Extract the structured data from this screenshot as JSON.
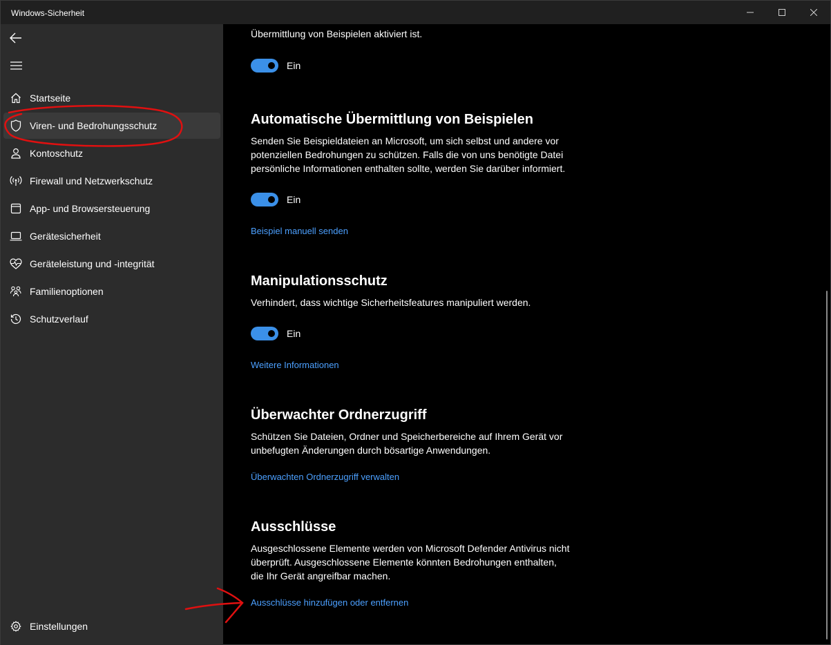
{
  "window": {
    "title": "Windows-Sicherheit"
  },
  "sidebar": {
    "items": [
      {
        "label": "Startseite",
        "icon": "home-icon"
      },
      {
        "label": "Viren- und Bedrohungsschutz",
        "icon": "shield-icon",
        "selected": true
      },
      {
        "label": "Kontoschutz",
        "icon": "person-icon"
      },
      {
        "label": "Firewall und Netzwerkschutz",
        "icon": "wifi-antenna-icon"
      },
      {
        "label": "App- und Browsersteuerung",
        "icon": "browser-window-icon"
      },
      {
        "label": "Gerätesicherheit",
        "icon": "laptop-icon"
      },
      {
        "label": "Geräteleistung und -integrität",
        "icon": "heart-pulse-icon"
      },
      {
        "label": "Familienoptionen",
        "icon": "family-icon"
      },
      {
        "label": "Schutzverlauf",
        "icon": "history-icon"
      }
    ],
    "settings_label": "Einstellungen"
  },
  "content": {
    "top_fragment": "Übermittlung von Beispielen aktiviert ist.",
    "top_toggle_label": "Ein",
    "auto_sample": {
      "title": "Automatische Übermittlung von Beispielen",
      "lines": [
        "Senden Sie Beispieldateien an Microsoft, um sich selbst und andere vor",
        "potenziellen Bedrohungen zu schützen. Falls die von uns benötigte Datei",
        "persönliche Informationen enthalten sollte, werden Sie darüber informiert."
      ],
      "toggle_label": "Ein",
      "link": "Beispiel manuell senden"
    },
    "tamper": {
      "title": "Manipulationsschutz",
      "lines": [
        "Verhindert, dass wichtige Sicherheitsfeatures manipuliert werden."
      ],
      "toggle_label": "Ein",
      "link": "Weitere Informationen"
    },
    "folder_access": {
      "title": "Überwachter Ordnerzugriff",
      "lines": [
        "Schützen Sie Dateien, Ordner und Speicherbereiche auf Ihrem Gerät vor",
        "unbefugten Änderungen durch bösartige Anwendungen."
      ],
      "link": "Überwachten Ordnerzugriff verwalten"
    },
    "exclusions": {
      "title": "Ausschlüsse",
      "lines": [
        "Ausgeschlossene Elemente werden von Microsoft Defender Antivirus nicht",
        "überprüft. Ausgeschlossene Elemente könnten Bedrohungen enthalten,",
        "die Ihr Gerät angreifbar machen."
      ],
      "link": "Ausschlüsse hinzufügen oder entfernen"
    }
  },
  "colors": {
    "accent": "#3b90e8",
    "link": "#4ca0ff",
    "sidebar_bg": "#2c2c2c",
    "annotation": "#e01010"
  }
}
